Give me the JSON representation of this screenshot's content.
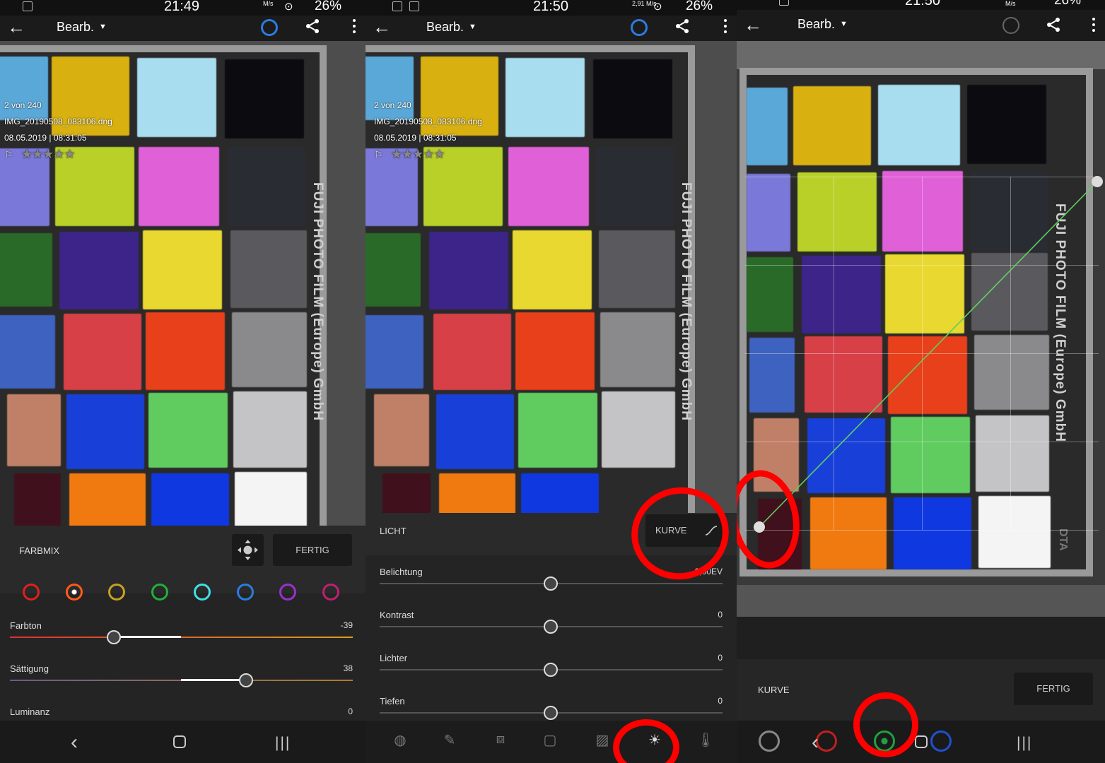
{
  "panels": {
    "p1": {
      "status": {
        "time": "21:49",
        "battery": "26%",
        "net": "M/s"
      },
      "appbar": {
        "back": "←",
        "title": "Bearb.",
        "caret": "▼"
      },
      "info": {
        "count": "2 von 240",
        "filename": "IMG_20190508_083106.dng",
        "datetime": "08.05.2019 | 08:31:05",
        "stars": "★★★★★",
        "flag": "⚐"
      },
      "photo": {
        "brand": "FUJI PHOTO FILM (Europe) GmbH"
      },
      "farbmix": {
        "title": "FARBMIX",
        "done": "FERTIG"
      },
      "colors": [
        "#e02020",
        "#ff5a1a",
        "#c9a020",
        "#20b040",
        "#40e0e8",
        "#2b7ce0",
        "#9a30d0",
        "#c02070"
      ],
      "sliders": [
        {
          "label": "Farbton",
          "value": "-39"
        },
        {
          "label": "Sättigung",
          "value": "38"
        },
        {
          "label": "Luminanz",
          "value": "0"
        }
      ],
      "nav": {
        "back": "‹",
        "recent": "|||"
      }
    },
    "p2": {
      "status": {
        "time": "21:50",
        "battery": "26%",
        "net": "2,91 M/s"
      },
      "appbar": {
        "back": "←",
        "title": "Bearb.",
        "caret": "▼"
      },
      "info": {
        "count": "2 von 240",
        "filename": "IMG_20190508_083106.dng",
        "datetime": "08.05.2019 | 08:31:05",
        "stars": "★★★★★",
        "flag": "⚐"
      },
      "photo": {
        "brand": "FUJI PHOTO FILM (Europe) GmbH"
      },
      "licht": {
        "title": "LICHT",
        "curve": "KURVE"
      },
      "sliders": [
        {
          "label": "Belichtung",
          "value": "0,00EV"
        },
        {
          "label": "Kontrast",
          "value": "0"
        },
        {
          "label": "Lichter",
          "value": "0"
        },
        {
          "label": "Tiefen",
          "value": "0"
        }
      ]
    },
    "p3": {
      "status": {
        "time": "21:50",
        "battery": "26%",
        "net": "M/s"
      },
      "appbar": {
        "back": "←",
        "title": "Bearb.",
        "caret": "▼"
      },
      "photo": {
        "brand": "FUJI PHOTO FILM (Europe) GmbH",
        "dta": "DTA"
      },
      "curve": {
        "title": "KURVE",
        "done": "FERTIG"
      },
      "channels": [
        "#888888",
        "#c02020",
        "#20a040",
        "#ffffff",
        "#2050d0"
      ],
      "nav": {
        "back": "‹",
        "recent": "|||"
      }
    }
  },
  "accent": "#2b7ce0",
  "annotation_color": "#ff0000"
}
